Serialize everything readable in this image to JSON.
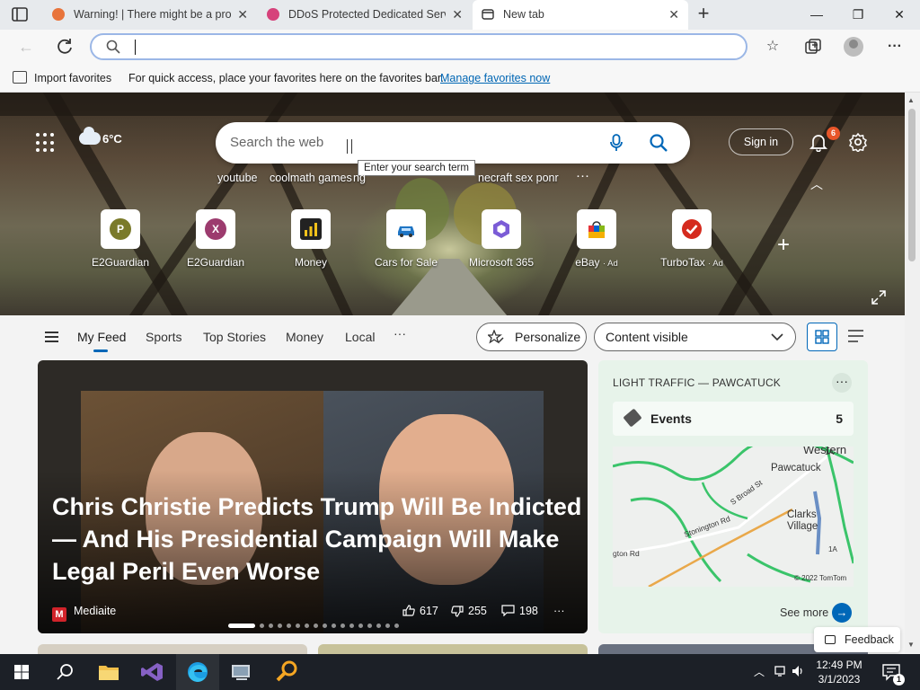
{
  "tabs": [
    {
      "title": "Warning! | There might be a prob",
      "active": false
    },
    {
      "title": "DDoS Protected Dedicated Serve",
      "active": false
    },
    {
      "title": "New tab",
      "active": true
    }
  ],
  "address_bar": {
    "value": "",
    "placeholder": ""
  },
  "favorites_bar": {
    "import_label": "Import favorites",
    "message": "For quick access, place your favorites here on the favorites bar.",
    "manage_link": "Manage favorites now"
  },
  "hero": {
    "weather": "6°C",
    "search_placeholder": "Search the web",
    "tooltip": "Enter your search term",
    "trending": [
      "youtube",
      "coolmath games",
      "ng",
      "necraft sex ponr"
    ],
    "sign_in": "Sign in",
    "notification_count": "6",
    "quick_links": [
      {
        "label": "E2Guardian",
        "letter": "P",
        "color": "#7a7a2a",
        "ad": ""
      },
      {
        "label": "E2Guardian",
        "letter": "X",
        "color": "#9c3b6e",
        "ad": ""
      },
      {
        "label": "Money",
        "letter": "",
        "color": "#222222",
        "ad": ""
      },
      {
        "label": "Cars for Sale",
        "letter": "",
        "color": "#1f75c4",
        "ad": ""
      },
      {
        "label": "Microsoft 365",
        "letter": "",
        "color": "#7b5cd6",
        "ad": ""
      },
      {
        "label": "eBay",
        "letter": "",
        "color": "#e53238",
        "ad": "· Ad"
      },
      {
        "label": "TurboTax",
        "letter": "",
        "color": "#d52b1e",
        "ad": "· Ad"
      }
    ]
  },
  "feed_nav": {
    "tabs": [
      "My Feed",
      "Sports",
      "Top Stories",
      "Money",
      "Local"
    ],
    "more": "···",
    "personalize": "Personalize",
    "content_visible": "Content visible"
  },
  "hero_article": {
    "title": "Chris Christie Predicts Trump Will Be Indicted — And His Presidential Campaign Will Make Legal Peril Even Worse",
    "source": "Mediaite",
    "source_logo": "M",
    "likes": "617",
    "dislikes": "255",
    "comments": "198",
    "more": "···",
    "dot_count": 17,
    "active_dot": 0
  },
  "traffic_card": {
    "title": "LIGHT TRAFFIC — PAWCATUCK",
    "events_label": "Events",
    "events_count": "5",
    "map_labels": [
      "Western",
      "Pawcatuck",
      "Clarks",
      "Village",
      "1A",
      "1A",
      "Stonington Rd",
      "S Broad St",
      "gton Rd"
    ],
    "copyright": "© 2022 TomTom",
    "see_more": "See more"
  },
  "feedback": "Feedback",
  "taskbar": {
    "time": "12:49 PM",
    "date": "3/1/2023",
    "notification_count": "1"
  }
}
